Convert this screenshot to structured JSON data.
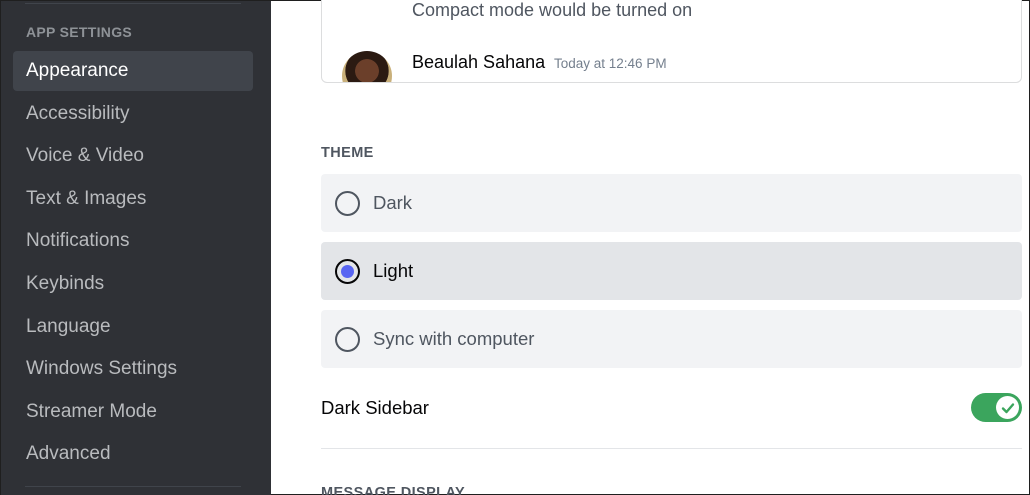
{
  "sidebar": {
    "header": "App Settings",
    "items": [
      {
        "label": "Appearance",
        "active": true
      },
      {
        "label": "Accessibility"
      },
      {
        "label": "Voice & Video"
      },
      {
        "label": "Text & Images"
      },
      {
        "label": "Notifications"
      },
      {
        "label": "Keybinds"
      },
      {
        "label": "Language"
      },
      {
        "label": "Windows Settings"
      },
      {
        "label": "Streamer Mode"
      },
      {
        "label": "Advanced"
      }
    ]
  },
  "preview": {
    "message": "Compact mode would be turned on",
    "author": "Beaulah Sahana",
    "timestamp": "Today at 12:46 PM"
  },
  "theme": {
    "title": "Theme",
    "options": [
      {
        "label": "Dark",
        "selected": false
      },
      {
        "label": "Light",
        "selected": true
      },
      {
        "label": "Sync with computer",
        "selected": false
      }
    ],
    "accent_color": "#5865f2"
  },
  "dark_sidebar": {
    "label": "Dark Sidebar",
    "enabled": true,
    "toggle_color": "#3ba55d"
  },
  "message_display": {
    "title": "Message Display"
  }
}
